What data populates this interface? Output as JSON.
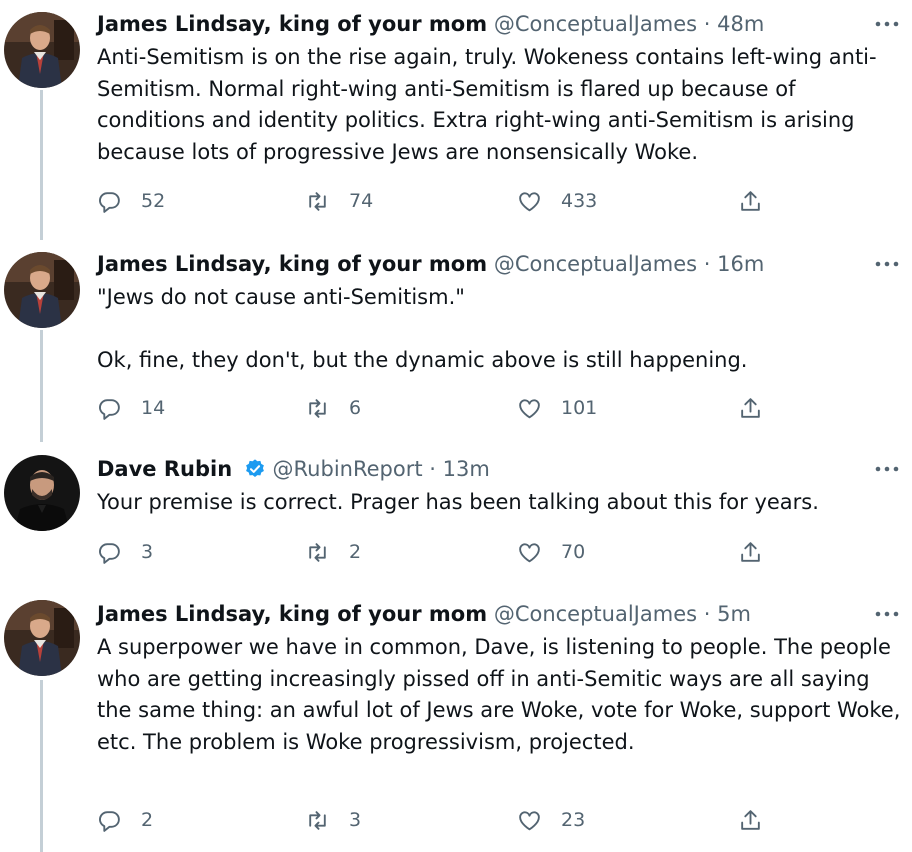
{
  "colors": {
    "text": "#0f1419",
    "secondary": "#536471",
    "thread_line": "#c4cfd6",
    "verified": "#1d9bf0"
  },
  "tweets": [
    {
      "author_name": "James Lindsay, king of your mom",
      "handle": "@ConceptualJames",
      "time": "48m",
      "paragraphs": [
        "Anti-Semitism is on the rise again, truly. Wokeness contains left-wing anti-Semitism. Normal right-wing anti-Semitism is flared up because of conditions and identity politics. Extra right-wing anti-Semitism is arising because lots of progressive Jews are nonsensically Woke."
      ],
      "replies": "52",
      "retweets": "74",
      "likes": "433"
    },
    {
      "author_name": "James Lindsay, king of your mom",
      "handle": "@ConceptualJames",
      "time": "16m",
      "paragraphs": [
        "\"Jews do not cause anti-Semitism.\"",
        "Ok, fine, they don't, but the dynamic above is still happening."
      ],
      "replies": "14",
      "retweets": "6",
      "likes": "101"
    },
    {
      "author_name": "Dave Rubin",
      "verified": true,
      "handle": "@RubinReport",
      "time": "13m",
      "paragraphs": [
        "Your premise is correct. Prager has been talking about this for years."
      ],
      "replies": "3",
      "retweets": "2",
      "likes": "70"
    },
    {
      "author_name": "James Lindsay, king of your mom",
      "handle": "@ConceptualJames",
      "time": "5m",
      "paragraphs": [
        "A superpower we have in common, Dave, is listening to people. The people who are getting increasingly pissed off in anti-Semitic ways are all saying the same thing: an awful lot of Jews are Woke, vote for Woke, support Woke, etc. The problem is Woke progressivism, projected."
      ],
      "replies": "2",
      "retweets": "3",
      "likes": "23"
    }
  ],
  "separator": "·",
  "icons": {
    "reply": "reply-icon",
    "retweet": "retweet-icon",
    "like": "heart-icon",
    "share": "share-icon",
    "more": "more-options-icon",
    "verified": "verified-badge-icon"
  }
}
